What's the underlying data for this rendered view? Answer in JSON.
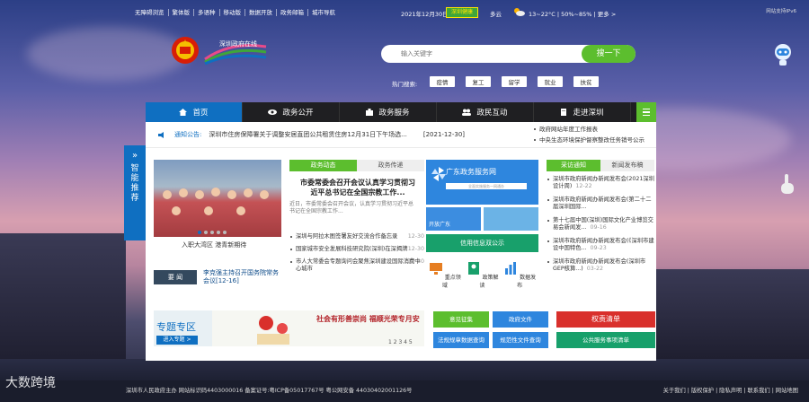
{
  "topbar": {
    "links": [
      "无障碍浏览",
      "繁体版",
      "多语种",
      "移动版",
      "数据开放",
      "政务邮箱",
      "城市导航"
    ],
    "date": "2021年12月30日 星期四",
    "badge": "深圳健康",
    "weather": "多云",
    "temp": "13~22°C | 50%~85% | 更多 >",
    "corner": "网站支持IPv6"
  },
  "logo": {
    "site_name": "深圳政府在线"
  },
  "search": {
    "placeholder": "输入关键字",
    "button": "搜一下",
    "hot_label": "热门搜索:",
    "hot_items": [
      "疫情",
      "复工",
      "留学",
      "就业",
      "扶贫"
    ]
  },
  "nav": [
    {
      "label": "首页"
    },
    {
      "label": "政务公开"
    },
    {
      "label": "政务服务"
    },
    {
      "label": "政民互动"
    },
    {
      "label": "走进深圳"
    }
  ],
  "notice": {
    "label": "通知公告:",
    "text": "深圳市住房保障署关于调整安居直团公共租赁住房12月31日下午场选...",
    "date": "[2021-12-30]",
    "side": [
      "政府网站年度工作报表",
      "中央生态环境保护督察整改任务销号公示"
    ]
  },
  "photo": {
    "caption": "入职大湾区 港青新期待"
  },
  "important": {
    "tag": "要 闻",
    "text": "李克强主持召开国务院常务会议[12-16]"
  },
  "center_tabs": [
    "政务动态",
    "政务传递"
  ],
  "headline": {
    "title": "市委常委会召开会议认真学习贯彻习近平总书记在全国宗教工作...",
    "summary": "近日，市委常委会召开会议，认真学习贯彻习近平总书记在全国宗教工作..."
  },
  "center_news": [
    {
      "text": "深圳与阿拉木图签署友好交流合作备忘录",
      "date": "12-30"
    },
    {
      "text": "国家城市安全发展科技研究院(深圳)在深揭牌",
      "date": "12-30"
    },
    {
      "text": "市人大常委会专题询问会聚焦深圳建设国际消费中心城市",
      "date": "12-30"
    }
  ],
  "service": {
    "title": "广东政务服务网",
    "search_hint": "全面实施服务一网通办",
    "tile1": "开放广东",
    "credit": "信用信息双公示",
    "icons": [
      "重点领域",
      "政策解读",
      "数据发布"
    ]
  },
  "right_tabs": [
    "采访通知",
    "新闻发布稿"
  ],
  "right_news": [
    {
      "text": "深圳市政府新闻办新闻发布会(2021深圳设计周)",
      "date": "12-22"
    },
    {
      "text": "深圳市政府新闻办新闻发布会(第二十二届深圳国际...",
      "date": ""
    },
    {
      "text": "第十七届中国(深圳)国际文化产业博览交易会新闻发...",
      "date": "09-16"
    },
    {
      "text": "深圳市政府新闻办新闻发布会(《深圳市建设中国特色...",
      "date": "09-23"
    },
    {
      "text": "深圳市政府新闻办新闻发布会(深圳市GEP核算...)",
      "date": "03-22"
    }
  ],
  "bottom": {
    "zt_title": "专题专区",
    "zt_btn": "进入专题 >",
    "zt_text": "社会有形善崇尚 福顺光荣专月安",
    "zt_num": "1 2 3 4 5",
    "green_buttons": [
      "意见征集",
      "政府文件",
      "法规规章数据查询",
      "规范性文件查询"
    ],
    "red_btn": "权责清单",
    "green_btn": "公共服务事项清单"
  },
  "sidetab": "智能推荐",
  "footer": {
    "left": "深圳市人民政府主办   网站标识码4403000016   备案证号:粤ICP备05017767号   粤公网安备 44030402001126号",
    "right": "关于我们 | 版权保护 | 隐私声明 | 联系我们 | 网站地图"
  },
  "watermark": "大数跨境",
  "colors": {
    "blue": "#0f6fc1",
    "green": "#5cbe2e",
    "red": "#d9302c",
    "teal": "#18a06b"
  }
}
